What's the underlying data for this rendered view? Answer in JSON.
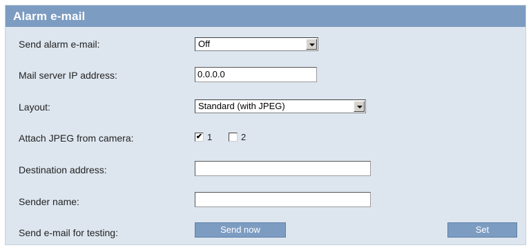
{
  "panel": {
    "title": "Alarm e-mail"
  },
  "fields": {
    "send_alarm": {
      "label": "Send alarm e-mail:",
      "value": "Off"
    },
    "mail_server": {
      "label": "Mail server IP address:",
      "value": "0.0.0.0"
    },
    "layout": {
      "label": "Layout:",
      "value": "Standard (with JPEG)"
    },
    "attach_jpeg": {
      "label": "Attach JPEG from camera:",
      "options": [
        {
          "label": "1",
          "checked": true,
          "mark": "✔"
        },
        {
          "label": "2",
          "checked": false,
          "mark": ""
        }
      ]
    },
    "destination": {
      "label": "Destination address:",
      "value": ""
    },
    "sender": {
      "label": "Sender name:",
      "value": ""
    },
    "test": {
      "label": "Send e-mail for testing:"
    }
  },
  "buttons": {
    "send_now": "Send now",
    "set": "Set"
  },
  "colors": {
    "header": "#7d9cc2",
    "panel_bg": "#dde6ef",
    "button": "#7d9cc2"
  }
}
